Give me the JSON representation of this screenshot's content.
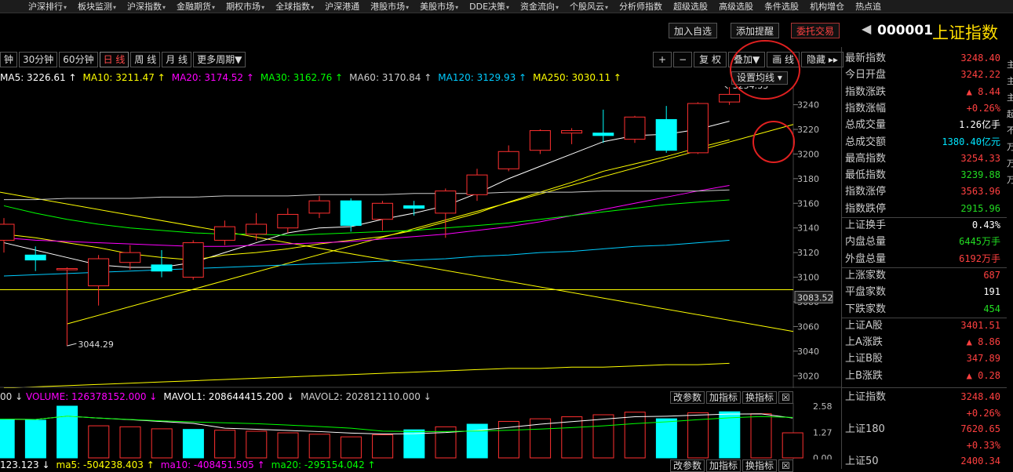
{
  "menu": [
    {
      "label": "沪深排行",
      "dropdown": true
    },
    {
      "label": "板块监测",
      "dropdown": true
    },
    {
      "label": "沪深指数",
      "dropdown": true
    },
    {
      "label": "金融期货",
      "dropdown": true
    },
    {
      "label": "期权市场",
      "dropdown": true
    },
    {
      "label": "全球指数",
      "dropdown": true
    },
    {
      "label": "沪深港通",
      "dropdown": false
    },
    {
      "label": "港股市场",
      "dropdown": true
    },
    {
      "label": "美股市场",
      "dropdown": true
    },
    {
      "label": "DDE决策",
      "dropdown": true
    },
    {
      "label": "资金流向",
      "dropdown": true
    },
    {
      "label": "个股风云",
      "dropdown": true
    },
    {
      "label": "分析师指数",
      "dropdown": false
    },
    {
      "label": "超级选股",
      "dropdown": false
    },
    {
      "label": "高级选股",
      "dropdown": false
    },
    {
      "label": "条件选股",
      "dropdown": false
    },
    {
      "label": "机构增仓",
      "dropdown": false
    },
    {
      "label": "热点追",
      "dropdown": false
    }
  ],
  "actions": {
    "add_watch": "加入自选",
    "add_alert": "添加提醒",
    "trade": "委托交易"
  },
  "symbol": {
    "code": "000001",
    "name": "上证指数",
    "arrow": "◀"
  },
  "periods": [
    "钟",
    "30分钟",
    "60分钟",
    "日 线",
    "周 线",
    "月 线",
    "更多周期▼"
  ],
  "tools": [
    "+",
    "−",
    "复 权",
    "叠加▼",
    "画 线",
    "隐藏 ▸▸"
  ],
  "settings_btn": "设置均线 ▾",
  "ma_legend": [
    {
      "text": "MA5: 3226.61 ↑",
      "color": "#ffffff"
    },
    {
      "text": "MA10: 3211.47 ↑",
      "color": "#ffff00"
    },
    {
      "text": "MA20: 3174.52 ↑",
      "color": "#ff00ff"
    },
    {
      "text": "MA30: 3162.76 ↑",
      "color": "#00ff00"
    },
    {
      "text": "MA60: 3170.84 ↑",
      "color": "#cccccc"
    },
    {
      "text": "MA120: 3129.93 ↑",
      "color": "#00ccff"
    },
    {
      "text": "MA250: 3030.11 ↑",
      "color": "#ffff00"
    }
  ],
  "price_axis": {
    "min": 3010,
    "max": 3255,
    "ticks": [
      3240,
      3220,
      3200,
      3180,
      3160,
      3140,
      3120,
      3100,
      3080,
      3060,
      3040,
      3020
    ],
    "current": "3083.52"
  },
  "annotations": {
    "high": "3254.33",
    "low": "3044.29"
  },
  "chart_data": {
    "type": "candlestick",
    "candles": [
      {
        "o": 3130,
        "c": 3143,
        "h": 3148,
        "l": 3120
      },
      {
        "o": 3118,
        "c": 3114,
        "h": 3125,
        "l": 3105
      },
      {
        "o": 3106,
        "c": 3107,
        "h": 3108,
        "l": 3044.29
      },
      {
        "o": 3093,
        "c": 3115,
        "h": 3118,
        "l": 3077
      },
      {
        "o": 3112,
        "c": 3120,
        "h": 3126,
        "l": 3106
      },
      {
        "o": 3110,
        "c": 3105,
        "h": 3122,
        "l": 3100
      },
      {
        "o": 3100,
        "c": 3128,
        "h": 3130,
        "l": 3098
      },
      {
        "o": 3130,
        "c": 3141,
        "h": 3146,
        "l": 3126
      },
      {
        "o": 3135,
        "c": 3143,
        "h": 3152,
        "l": 3130
      },
      {
        "o": 3140,
        "c": 3151,
        "h": 3156,
        "l": 3136
      },
      {
        "o": 3152,
        "c": 3162,
        "h": 3166,
        "l": 3148
      },
      {
        "o": 3162,
        "c": 3142,
        "h": 3164,
        "l": 3137
      },
      {
        "o": 3147,
        "c": 3160,
        "h": 3162,
        "l": 3138
      },
      {
        "o": 3158,
        "c": 3156,
        "h": 3162,
        "l": 3150
      },
      {
        "o": 3152,
        "c": 3170,
        "h": 3172,
        "l": 3132
      },
      {
        "o": 3167,
        "c": 3183,
        "h": 3188,
        "l": 3162
      },
      {
        "o": 3188,
        "c": 3202,
        "h": 3207,
        "l": 3186
      },
      {
        "o": 3203,
        "c": 3219,
        "h": 3220,
        "l": 3200
      },
      {
        "o": 3217,
        "c": 3219,
        "h": 3221,
        "l": 3208
      },
      {
        "o": 3217,
        "c": 3215,
        "h": 3236,
        "l": 3209
      },
      {
        "o": 3212,
        "c": 3230,
        "h": 3231,
        "l": 3209
      },
      {
        "o": 3228,
        "c": 3203,
        "h": 3239,
        "l": 3201
      },
      {
        "o": 3201,
        "c": 3241,
        "h": 3242,
        "l": 3200
      },
      {
        "o": 3242.22,
        "c": 3248.4,
        "h": 3254.33,
        "l": 3239.88
      }
    ],
    "ma_lines": [
      {
        "name": "MA5",
        "color": "#ffffff",
        "values": [
          3128,
          3122,
          3116,
          3110,
          3108,
          3108,
          3112,
          3120,
          3128,
          3136,
          3140,
          3141,
          3147,
          3152,
          3158,
          3168,
          3180,
          3190,
          3200,
          3210,
          3215,
          3216,
          3220,
          3226.61
        ]
      },
      {
        "name": "MA10",
        "color": "#ffff00",
        "values": [
          3135,
          3132,
          3128,
          3124,
          3119,
          3116,
          3114,
          3118,
          3120,
          3123,
          3127,
          3130,
          3133,
          3138,
          3145,
          3152,
          3161,
          3169,
          3177,
          3186,
          3192,
          3198,
          3205,
          3211.47
        ]
      },
      {
        "name": "MA20",
        "color": "#ff00ff",
        "values": [
          3132,
          3130,
          3129,
          3128,
          3127,
          3126,
          3125,
          3125,
          3126,
          3127,
          3128,
          3129,
          3131,
          3133,
          3135,
          3138,
          3141,
          3145,
          3150,
          3155,
          3160,
          3165,
          3170,
          3174.52
        ]
      },
      {
        "name": "MA30",
        "color": "#00ff00",
        "values": [
          3158,
          3152,
          3147,
          3143,
          3140,
          3138,
          3136,
          3135,
          3135,
          3134,
          3135,
          3136,
          3137,
          3138,
          3140,
          3142,
          3144,
          3147,
          3150,
          3153,
          3156,
          3159,
          3161,
          3162.76
        ]
      },
      {
        "name": "MA60",
        "color": "#cccccc",
        "values": [
          3163,
          3163,
          3164,
          3164,
          3164,
          3165,
          3165,
          3166,
          3166,
          3166,
          3167,
          3167,
          3167,
          3168,
          3168,
          3168,
          3169,
          3169,
          3169,
          3170,
          3170,
          3170,
          3170,
          3170.84
        ]
      },
      {
        "name": "MA120",
        "color": "#00ccff",
        "values": [
          3101,
          3102,
          3103,
          3104,
          3105,
          3106,
          3107,
          3108,
          3109,
          3110,
          3111,
          3112,
          3113,
          3114,
          3115,
          3117,
          3118,
          3120,
          3121,
          3123,
          3125,
          3126,
          3128,
          3129.93
        ]
      },
      {
        "name": "MA250",
        "color": "#ffff00",
        "values": [
          3010,
          3011,
          3012,
          3013,
          3014,
          3015,
          3016,
          3017,
          3018,
          3019,
          3020,
          3021,
          3022,
          3023,
          3024,
          3025,
          3026,
          3026,
          3027,
          3027,
          3028,
          3029,
          3029,
          3030.11
        ]
      }
    ],
    "volume_legend": [
      {
        "text": "VOLUME: 126378152.000 ↓",
        "color": "#ff00ff"
      },
      {
        "text": "MAVOL1: 208644415.200 ↓",
        "color": "#ffffff"
      },
      {
        "text": "MAVOL2: 202812110.000 ↓",
        "color": "#cccccc"
      }
    ],
    "volume_axis": {
      "ticks": [
        "2.58",
        "1.27",
        "0.00"
      ],
      "max": 2.58
    },
    "volume": [
      1.95,
      1.92,
      1.88,
      2.58,
      1.6,
      1.55,
      1.45,
      1.42,
      1.38,
      1.33,
      1.25,
      1.18,
      1.05,
      1.15,
      1.4,
      1.55,
      1.68,
      1.82,
      1.95,
      2.05,
      2.15,
      2.28,
      1.95,
      2.25,
      2.3,
      2.2,
      1.25
    ],
    "volume_up": [
      false,
      false,
      false,
      false,
      true,
      true,
      true,
      false,
      true,
      true,
      true,
      true,
      true,
      true,
      false,
      true,
      false,
      true,
      true,
      true,
      true,
      true,
      false,
      true,
      false,
      true,
      true
    ]
  },
  "vol_buttons": [
    "改参数",
    "加指标",
    "换指标",
    "☒"
  ],
  "bottom_legend": [
    {
      "text": "123.123 ↓",
      "color": "#ffffff"
    },
    {
      "text": "ma5: -504238.403 ↑",
      "color": "#ffff00"
    },
    {
      "text": "ma10: -408451.505 ↑",
      "color": "#ff00ff"
    },
    {
      "text": "ma20: -295154.042 ↑",
      "color": "#00ff00"
    }
  ],
  "panel": {
    "rows": [
      {
        "label": "最新指数",
        "value": "3248.40",
        "cls": "red"
      },
      {
        "label": "今日开盘",
        "value": "3242.22",
        "cls": "red"
      },
      {
        "label": "指数涨跌",
        "value": "▲ 8.44",
        "cls": "red"
      },
      {
        "label": "指数涨幅",
        "value": "+0.26%",
        "cls": "red"
      },
      {
        "label": "总成交量",
        "value": "1.26亿手",
        "cls": "white"
      },
      {
        "label": "总成交额",
        "value": "1380.40亿元",
        "cls": "cyan"
      },
      {
        "label": "最高指数",
        "value": "3254.33",
        "cls": "red"
      },
      {
        "label": "最低指数",
        "value": "3239.88",
        "cls": "green"
      },
      {
        "label": "指数涨停",
        "value": "3563.96",
        "cls": "red"
      },
      {
        "label": "指数跌停",
        "value": "2915.96",
        "cls": "green"
      },
      {
        "label": "上证换手",
        "value": "0.43%",
        "cls": "white"
      },
      {
        "label": "内盘总量",
        "value": "6445万手",
        "cls": "green"
      },
      {
        "label": "外盘总量",
        "value": "6192万手",
        "cls": "red"
      },
      {
        "label": "上涨家数",
        "value": "687",
        "cls": "red"
      },
      {
        "label": "平盘家数",
        "value": "191",
        "cls": "white"
      },
      {
        "label": "下跌家数",
        "value": "454",
        "cls": "green"
      },
      {
        "label": "上证A股",
        "value": "3401.51",
        "cls": "red"
      },
      {
        "label": "上A涨跌",
        "value": "▲ 8.86",
        "cls": "red"
      },
      {
        "label": "上证B股",
        "value": "347.89",
        "cls": "red"
      },
      {
        "label": "上B涨跌",
        "value": "▲ 0.28",
        "cls": "red"
      }
    ],
    "bottom": [
      {
        "label": "上证指数",
        "value": "3248.40",
        "cls": "red"
      },
      {
        "label": "",
        "value": "+0.26%",
        "cls": "red"
      },
      {
        "label": "上证180",
        "value": "7620.65",
        "cls": "red"
      },
      {
        "label": "",
        "value": "+0.33%",
        "cls": "red"
      },
      {
        "label": "上证50",
        "value": "2400.34",
        "cls": "red"
      }
    ]
  },
  "edge_chars": [
    "主",
    "主",
    "主",
    "起",
    "不",
    "万",
    "万",
    "万"
  ]
}
